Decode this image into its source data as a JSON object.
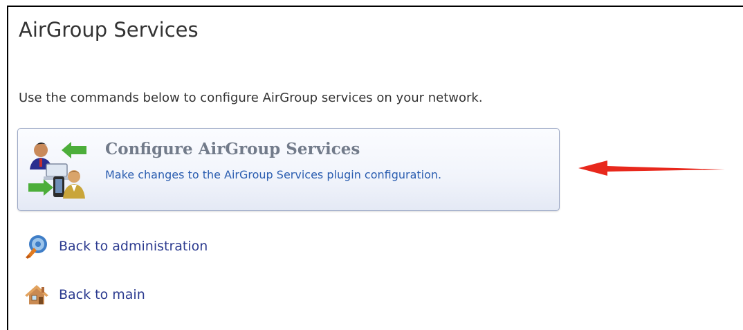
{
  "page": {
    "title": "AirGroup Services",
    "intro": "Use the commands below to configure AirGroup services on your network."
  },
  "command": {
    "title": "Configure AirGroup Services",
    "description": "Make changes to the AirGroup Services plugin configuration.",
    "icon": "users-sync-icon"
  },
  "links": {
    "admin": {
      "label": "Back to administration",
      "icon": "administration-icon"
    },
    "main": {
      "label": "Back to main",
      "icon": "home-icon"
    }
  },
  "annotation": {
    "icon": "red-arrow",
    "color": "#e8281c"
  },
  "colors": {
    "link": "#2b3a8f",
    "description": "#2a5db0",
    "card_title": "#727b8a",
    "text": "#333333"
  }
}
